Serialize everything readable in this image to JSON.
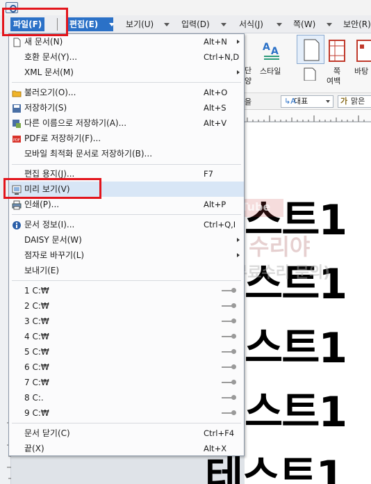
{
  "menubar": {
    "items": [
      {
        "label": "파일(F)",
        "active": true
      },
      {
        "label": "편집(E)"
      },
      {
        "label": "보기(U)"
      },
      {
        "label": "입력(D)"
      },
      {
        "label": "서식(J)"
      },
      {
        "label": "쪽(W)"
      },
      {
        "label": "보안(R)"
      }
    ]
  },
  "ribbon": {
    "style_label": "스타일",
    "page_margin_label1": "쪽",
    "page_margin_label2": "여백",
    "background_label": "바탕",
    "partial_label1": "단",
    "partial_label2": "양"
  },
  "format_bar": {
    "style_value": "대표",
    "font_value": "맑은",
    "left_partial": "을"
  },
  "file_menu": {
    "items": [
      {
        "label": "새 문서(N)",
        "shortcut": "Alt+N",
        "submenu": true
      },
      {
        "label": "호환 문서(Y)...",
        "shortcut": "Ctrl+N,D"
      },
      {
        "label": "XML 문서(M)",
        "submenu": true
      },
      {
        "label": "불러오기(O)...",
        "shortcut": "Alt+O"
      },
      {
        "label": "저장하기(S)",
        "shortcut": "Alt+S"
      },
      {
        "label": "다른 이름으로 저장하기(A)...",
        "shortcut": "Alt+V"
      },
      {
        "label": "PDF로 저장하기(F)..."
      },
      {
        "label": "모바일 최적화 문서로 저장하기(B)..."
      },
      {
        "label": "편집 용지(J)...",
        "shortcut": "F7"
      },
      {
        "label": "미리 보기(V)",
        "highlighted": true
      },
      {
        "label": "인쇄(P)...",
        "shortcut": "Alt+P"
      },
      {
        "label": "문서 정보(I)...",
        "shortcut": "Ctrl+Q,I"
      },
      {
        "label": "DAISY 문서(W)",
        "submenu": true
      },
      {
        "label": "점자로 바꾸기(L)",
        "submenu": true
      },
      {
        "label": "보내기(E)"
      },
      {
        "label": "1 C:₩"
      },
      {
        "label": "2 C:₩"
      },
      {
        "label": "3 C:₩"
      },
      {
        "label": "4 C:₩"
      },
      {
        "label": "5 C:₩"
      },
      {
        "label": "6 C:₩"
      },
      {
        "label": "7 C:₩"
      },
      {
        "label": "8 C:."
      },
      {
        "label": "9 C:₩"
      },
      {
        "label": "문서 닫기(C)",
        "shortcut": "Ctrl+F4"
      },
      {
        "label": "끝(X)",
        "shortcut": "Alt+X"
      }
    ]
  },
  "document": {
    "lines": [
      "스트1",
      "스트1",
      "스트1",
      "스트1",
      "테스트1"
    ]
  },
  "watermark": {
    "line1": "PC",
    "line2": "맨날 수리야",
    "line3": "(PC 무료수리 문의)",
    "youtube": "YouTube"
  },
  "colors": {
    "menu_active": "#2b71c7",
    "highlight_row": "#d8e6f6",
    "annotation_red": "#e3141b"
  }
}
